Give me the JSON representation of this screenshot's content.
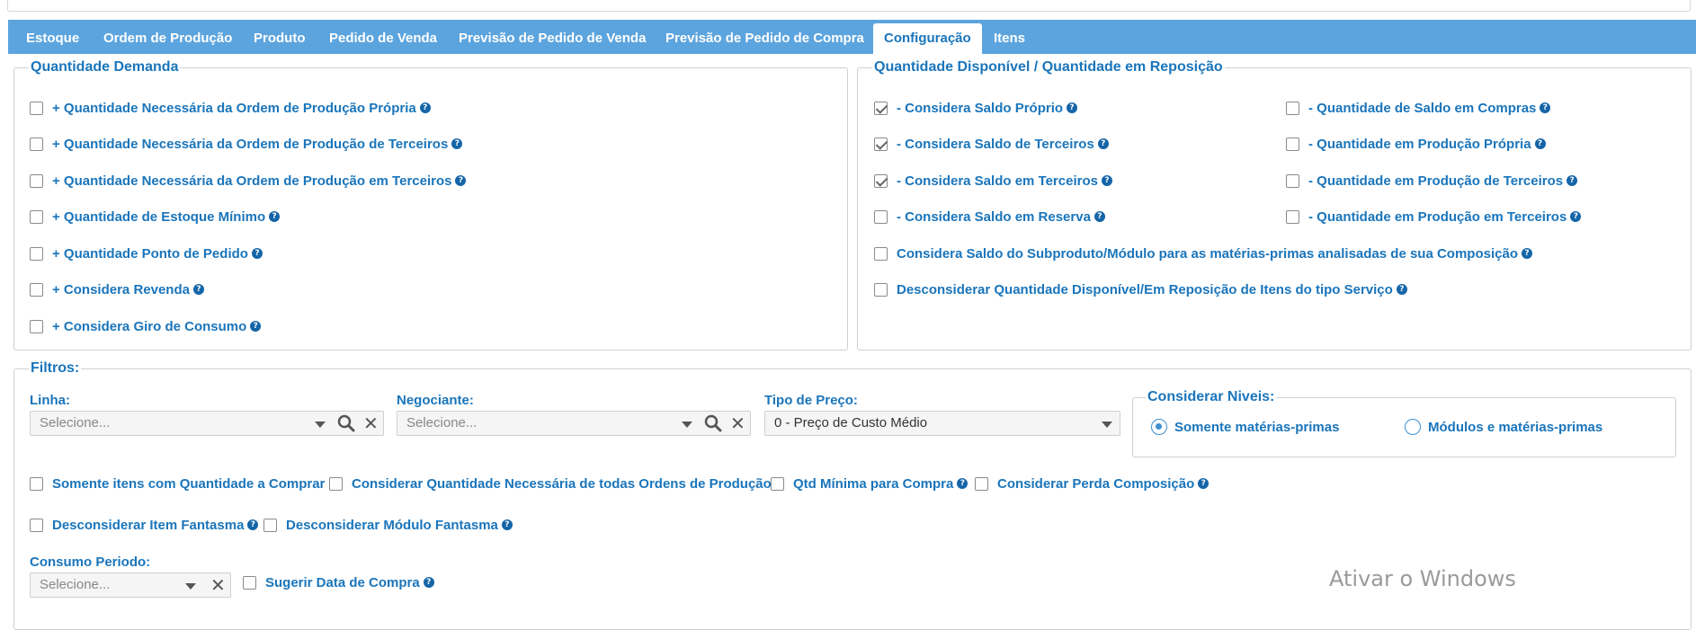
{
  "tabs": [
    {
      "label": "Estoque"
    },
    {
      "label": "Ordem de Produção"
    },
    {
      "label": "Produto"
    },
    {
      "label": "Pedido de Venda"
    },
    {
      "label": "Previsão de Pedido de Venda"
    },
    {
      "label": "Previsão de Pedido de Compra"
    },
    {
      "label": "Configuração"
    },
    {
      "label": "Itens"
    }
  ],
  "demanda": {
    "title": "Quantidade Demanda",
    "items": [
      {
        "label": "+ Quantidade Necessária da Ordem de Produção Própria"
      },
      {
        "label": "+ Quantidade Necessária da Ordem de Produção de Terceiros"
      },
      {
        "label": "+ Quantidade Necessária da Ordem de Produção em Terceiros"
      },
      {
        "label": "+ Quantidade de Estoque Mínimo"
      },
      {
        "label": "+ Quantidade Ponto de Pedido"
      },
      {
        "label": "+ Considera Revenda"
      },
      {
        "label": "+ Considera Giro de Consumo"
      }
    ]
  },
  "disponivel": {
    "title": "Quantidade Disponível / Quantidade em Reposição",
    "left": [
      {
        "label": "- Considera Saldo Próprio",
        "checked": true
      },
      {
        "label": "- Considera Saldo de Terceiros",
        "checked": true
      },
      {
        "label": "- Considera Saldo em Terceiros",
        "checked": true
      },
      {
        "label": "- Considera Saldo em Reserva",
        "checked": false
      }
    ],
    "right": [
      {
        "label": "- Quantidade de Saldo em Compras"
      },
      {
        "label": "- Quantidade em Produção Própria"
      },
      {
        "label": "- Quantidade em Produção de Terceiros"
      },
      {
        "label": "- Quantidade em Produção em Terceiros"
      }
    ],
    "wide": [
      {
        "label": "Considera Saldo do Subproduto/Módulo para as matérias-primas analisadas de sua Composição"
      },
      {
        "label": "Desconsiderar Quantidade Disponível/Em Reposição de Itens do tipo Serviço"
      }
    ]
  },
  "filtros": {
    "title": "Filtros:",
    "linha": {
      "label": "Linha:",
      "placeholder": "Selecione..."
    },
    "negociante": {
      "label": "Negociante:",
      "placeholder": "Selecione..."
    },
    "tipo_preco": {
      "label": "Tipo de Preço:",
      "value": "0 - Preço de Custo Médio"
    },
    "niveis": {
      "title": "Considerar Niveis:",
      "options": [
        {
          "label": "Somente matérias-primas",
          "selected": true
        },
        {
          "label": "Módulos e matérias-primas",
          "selected": false
        }
      ]
    },
    "opcoes1": [
      {
        "label": "Somente itens com Quantidade a Comprar"
      },
      {
        "label": "Considerar Quantidade Necessária de todas Ordens de Produção"
      },
      {
        "label": "Qtd Mínima para Compra"
      },
      {
        "label": "Considerar Perda Composição"
      }
    ],
    "opcoes2": [
      {
        "label": "Desconsiderar Item Fantasma"
      },
      {
        "label": "Desconsiderar Módulo Fantasma"
      }
    ],
    "consumo": {
      "label": "Consumo Periodo:",
      "placeholder": "Selecione..."
    },
    "sugerir": {
      "label": "Sugerir Data de Compra"
    }
  },
  "watermark": "Ativar o Windows",
  "help_glyph": "?",
  "clear_glyph": "✕"
}
